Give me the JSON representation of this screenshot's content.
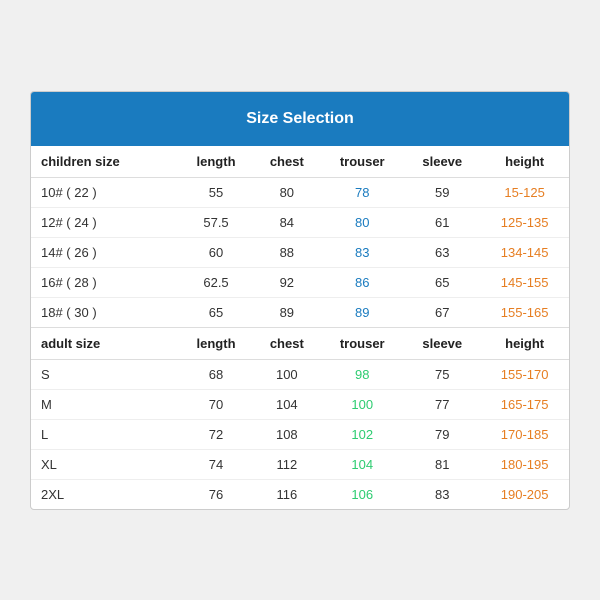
{
  "header": {
    "title": "Size Selection",
    "bg_color": "#1a7bbf"
  },
  "children_section": {
    "label": "children size",
    "columns": [
      "length",
      "chest",
      "trouser",
      "sleeve",
      "height"
    ],
    "rows": [
      {
        "size": "10# ( 22 )",
        "length": "55",
        "chest": "80",
        "trouser": "78",
        "sleeve": "59",
        "height": "15-125"
      },
      {
        "size": "12# ( 24 )",
        "length": "57.5",
        "chest": "84",
        "trouser": "80",
        "sleeve": "61",
        "height": "125-135"
      },
      {
        "size": "14# ( 26 )",
        "length": "60",
        "chest": "88",
        "trouser": "83",
        "sleeve": "63",
        "height": "134-145"
      },
      {
        "size": "16# ( 28 )",
        "length": "62.5",
        "chest": "92",
        "trouser": "86",
        "sleeve": "65",
        "height": "145-155"
      },
      {
        "size": "18# ( 30 )",
        "length": "65",
        "chest": "89",
        "trouser": "89",
        "sleeve": "67",
        "height": "155-165"
      }
    ]
  },
  "adult_section": {
    "label": "adult size",
    "columns": [
      "length",
      "chest",
      "trouser",
      "sleeve",
      "height"
    ],
    "rows": [
      {
        "size": "S",
        "length": "68",
        "chest": "100",
        "trouser": "98",
        "sleeve": "75",
        "height": "155-170"
      },
      {
        "size": "M",
        "length": "70",
        "chest": "104",
        "trouser": "100",
        "sleeve": "77",
        "height": "165-175"
      },
      {
        "size": "L",
        "length": "72",
        "chest": "108",
        "trouser": "102",
        "sleeve": "79",
        "height": "170-185"
      },
      {
        "size": "XL",
        "length": "74",
        "chest": "112",
        "trouser": "104",
        "sleeve": "81",
        "height": "180-195"
      },
      {
        "size": "2XL",
        "length": "76",
        "chest": "116",
        "trouser": "106",
        "sleeve": "83",
        "height": "190-205"
      }
    ]
  }
}
